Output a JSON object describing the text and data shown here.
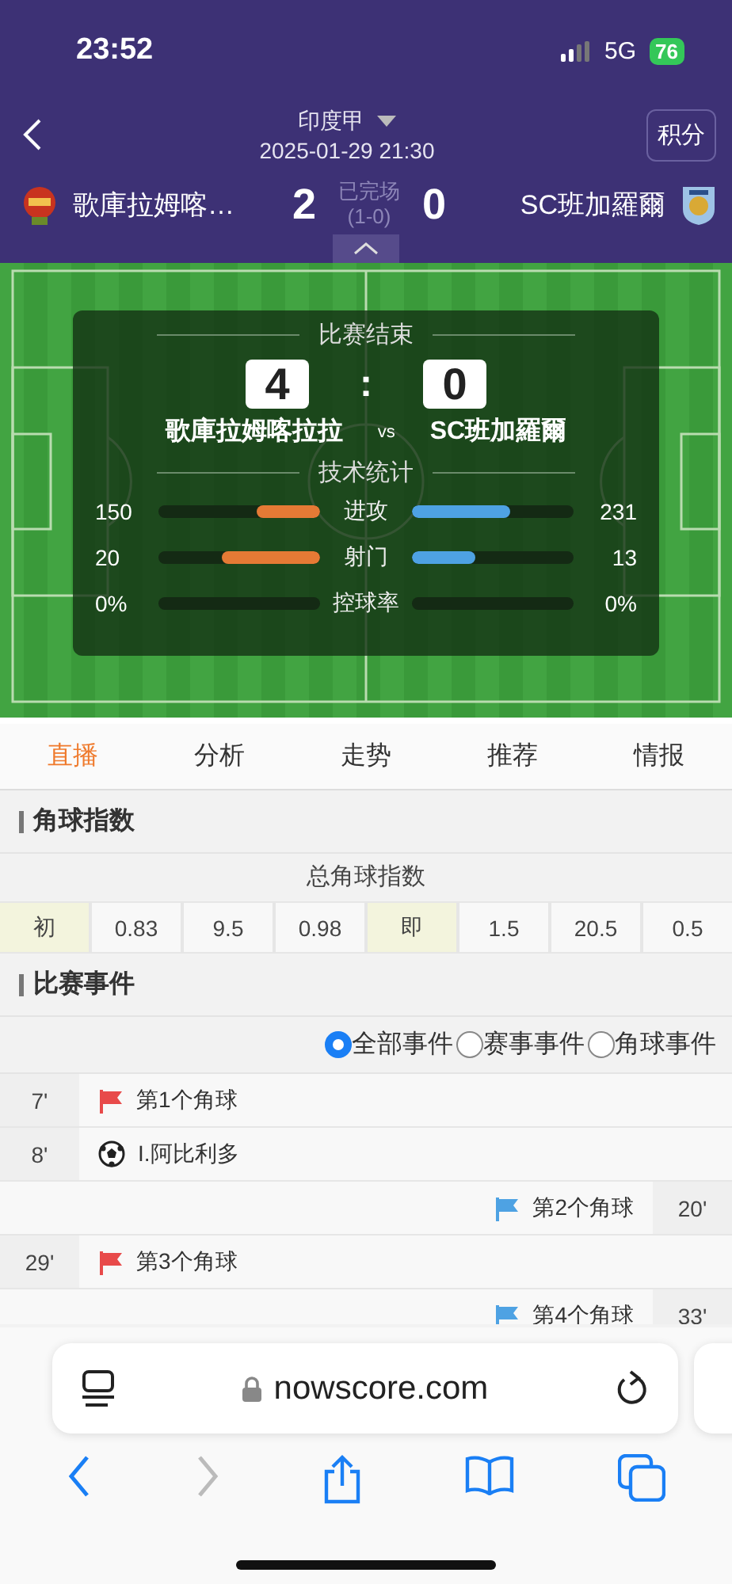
{
  "status_bar": {
    "time": "23:52",
    "network": "5G",
    "battery": "76"
  },
  "header": {
    "league": "印度甲",
    "datetime": "2025-01-29 21:30",
    "standings_button": "积分",
    "home": {
      "name": "歌庫拉姆喀…",
      "score": "2"
    },
    "status": "已完场",
    "half_score": "(1-0)",
    "away": {
      "name": "SC班加羅爾",
      "score": "0"
    }
  },
  "match_card": {
    "title": "比赛结束",
    "home_score": "4",
    "separator": ":",
    "away_score": "0",
    "home_name": "歌庫拉姆喀拉拉",
    "vs": "vs",
    "away_name": "SC班加羅爾",
    "stats_title": "技术统计",
    "stats": [
      {
        "label": "进攻",
        "home": {
          "value": "150",
          "level": 0.39
        },
        "away": {
          "value": "231",
          "level": 0.61
        }
      },
      {
        "label": "射门",
        "home": {
          "value": "20",
          "level": 0.61
        },
        "away": {
          "value": "13",
          "level": 0.39
        }
      },
      {
        "label": "控球率",
        "home": {
          "value": "0%",
          "level": 0
        },
        "away": {
          "value": "0%",
          "level": 0
        }
      }
    ]
  },
  "tabs": [
    {
      "label": "直播",
      "selected": true
    },
    {
      "label": "分析",
      "selected": false
    },
    {
      "label": "走势",
      "selected": false
    },
    {
      "label": "推荐",
      "selected": false
    },
    {
      "label": "情报",
      "selected": false
    }
  ],
  "corner_index": {
    "title": "角球指数",
    "subtitle": "总角球指数",
    "cells": [
      {
        "text": "初",
        "kind": "label"
      },
      {
        "text": "0.83",
        "kind": "value"
      },
      {
        "text": "9.5",
        "kind": "value"
      },
      {
        "text": "0.98",
        "kind": "value"
      },
      {
        "text": "即",
        "kind": "label"
      },
      {
        "text": "1.5",
        "kind": "value"
      },
      {
        "text": "20.5",
        "kind": "value"
      },
      {
        "text": "0.5",
        "kind": "value"
      }
    ]
  },
  "events": {
    "title": "比赛事件",
    "filters": [
      {
        "label": "全部事件",
        "selected": true
      },
      {
        "label": "赛事事件",
        "selected": false
      },
      {
        "label": "角球事件",
        "selected": false
      }
    ],
    "rows": [
      {
        "minute": "7'",
        "home": {
          "kind": "corner",
          "text": "第1个角球"
        }
      },
      {
        "minute": "8'",
        "home": {
          "kind": "goal",
          "text": "I.阿比利多"
        }
      },
      {
        "minute": "20'",
        "away": {
          "kind": "corner",
          "text": "第2个角球"
        }
      },
      {
        "minute": "29'",
        "home": {
          "kind": "corner",
          "text": "第3个角球"
        }
      },
      {
        "minute": "33'",
        "away": {
          "kind": "corner",
          "text": "第4个角球"
        }
      }
    ]
  },
  "browser": {
    "url": "nowscore.com"
  }
}
